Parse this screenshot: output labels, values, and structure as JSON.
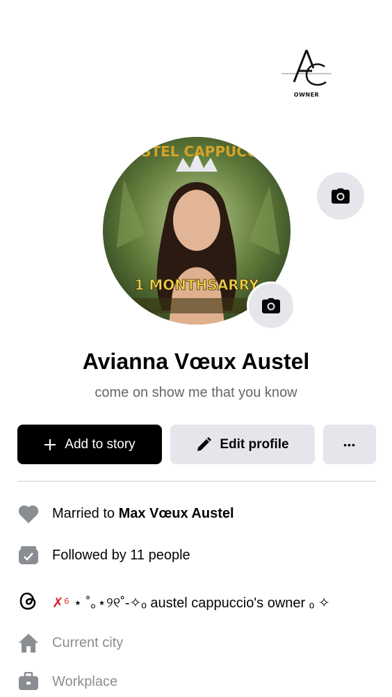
{
  "logo": {
    "brand": "AUSTEL CAPPUCCIO",
    "monogram": "AC",
    "badge": "OWNER"
  },
  "profile": {
    "name": "Avianna Vœux Austel",
    "bio": "come on show me that you know",
    "avatar_text_top": "AUSTEL CAPPUCCIO",
    "avatar_text_bottom": "1 MONTHSARRY"
  },
  "actions": {
    "add_story": "Add to story",
    "edit_profile": "Edit profile",
    "more": "•••"
  },
  "details": {
    "married_prefix": "Married to ",
    "married_name": "Max Vœux Austel",
    "followed": "Followed by 11 people",
    "threads_prefix": "✗⁶",
    "threads_text": "⋆ ˚｡⋆୨୧˚-✧ₒ austel cappuccio's owner ₒ ✧",
    "current_city": "Current city",
    "workplace": "Workplace"
  },
  "icons": [
    "camera-icon",
    "plus-icon",
    "pencil-icon",
    "more-icon",
    "heart-icon",
    "followers-icon",
    "threads-icon",
    "home-icon",
    "briefcase-icon"
  ],
  "colors": {
    "primary_button": "#000000",
    "secondary_button": "#e4e6eb",
    "muted_text": "#65676b",
    "icon_gray": "#8a8d91"
  }
}
